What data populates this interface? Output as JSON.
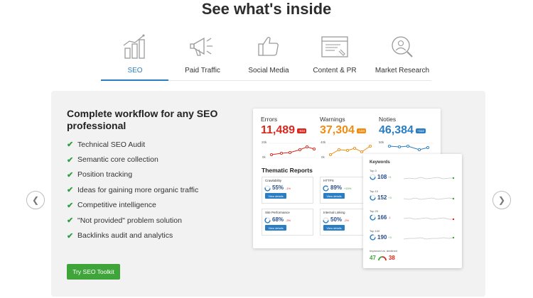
{
  "page": {
    "title": "See what's inside"
  },
  "tabs": [
    {
      "label": "SEO",
      "icon": "bar-chart-icon",
      "active": true
    },
    {
      "label": "Paid Traffic",
      "icon": "megaphone-icon",
      "active": false
    },
    {
      "label": "Social Media",
      "icon": "thumbs-up-icon",
      "active": false
    },
    {
      "label": "Content & PR",
      "icon": "browser-window-icon",
      "active": false
    },
    {
      "label": "Market Research",
      "icon": "magnifier-person-icon",
      "active": false
    }
  ],
  "panel": {
    "heading": "Complete workflow for any SEO professional",
    "features": [
      "Technical SEO Audit",
      "Semantic core collection",
      "Position tracking",
      "Ideas for gaining more organic traffic",
      "Competitive intelligence",
      "\"Not provided\" problem solution",
      "Backlinks audit and analytics"
    ],
    "cta_label": "Try SEO Toolkit"
  },
  "nav": {
    "prev_icon": "chevron-left-icon",
    "next_icon": "chevron-right-icon"
  },
  "dashboard": {
    "metrics": [
      {
        "label": "Errors",
        "value": "11,489",
        "badge": "-834",
        "color": "#d9281e"
      },
      {
        "label": "Warnings",
        "value": "37,304",
        "badge": "-104",
        "color": "#f08c12"
      },
      {
        "label": "Noties",
        "value": "46,384",
        "badge": "+112",
        "color": "#2a7dc3"
      }
    ],
    "axis_labels": {
      "errors_top": "20k",
      "errors_bottom": "0k",
      "warnings_top": "40k",
      "warnings_bottom": "0k",
      "noties_top": "50k"
    },
    "thematic_title": "Thematic Reports",
    "thematic": [
      {
        "name": "Crawlability",
        "pct": "55%",
        "change": "-1%",
        "change_color": "#d9281e",
        "progress": 0.55
      },
      {
        "name": "HTTPS",
        "pct": "89%",
        "change": "+15%",
        "change_color": "#3fa53a",
        "progress": 0.89
      },
      {
        "name": "Site Performance",
        "pct": "68%",
        "change": "-3%",
        "change_color": "#d9281e",
        "progress": 0.68
      },
      {
        "name": "Internal Linking",
        "pct": "50%",
        "change": "-2%",
        "change_color": "#d9281e",
        "progress": 0.5
      }
    ],
    "view_details_label": "View details",
    "keywords": {
      "title": "Keywords",
      "rows": [
        {
          "label": "Top 3",
          "value": "108",
          "change": "+1",
          "change_color": "#3fa53a"
        },
        {
          "label": "Top 10",
          "value": "152",
          "change": "+3",
          "change_color": "#3fa53a"
        },
        {
          "label": "Top 20",
          "value": "166",
          "change": "-1",
          "change_color": "#d9281e"
        },
        {
          "label": "Top 100",
          "value": "190",
          "change": "+3",
          "change_color": "#3fa53a"
        }
      ],
      "improved_label": "Improved vs. declined",
      "improved": "47",
      "declined": "38"
    }
  }
}
